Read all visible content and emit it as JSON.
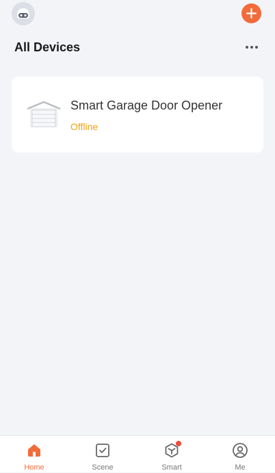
{
  "header": {
    "title": "All Devices",
    "add_icon": "plus-icon",
    "more_icon": "ellipsis-icon",
    "avatar_icon": "robot-avatar-icon"
  },
  "devices": [
    {
      "name": "Smart Garage Door Opener",
      "status": "Offline",
      "icon": "garage-door-icon"
    }
  ],
  "tabs": [
    {
      "label": "Home",
      "icon": "home-icon",
      "active": true
    },
    {
      "label": "Scene",
      "icon": "checkbox-icon",
      "active": false
    },
    {
      "label": "Smart",
      "icon": "cube-icon",
      "active": false,
      "badge": true
    },
    {
      "label": "Me",
      "icon": "user-circle-icon",
      "active": false
    }
  ],
  "colors": {
    "accent": "#f26b3a",
    "offline": "#f0a20f",
    "background": "#f3f4f8",
    "badge": "#f04a3a"
  }
}
